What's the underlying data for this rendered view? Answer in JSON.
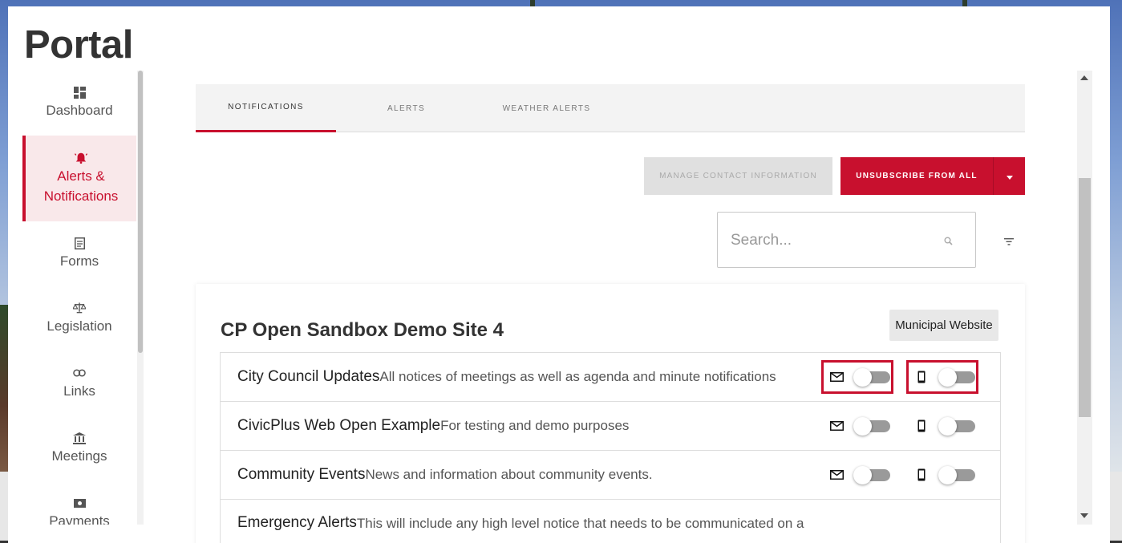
{
  "app": {
    "title": "Portal"
  },
  "sidebar": {
    "items": [
      {
        "label": "Dashboard",
        "icon": "dashboard-icon",
        "active": false
      },
      {
        "label": "Alerts & Notifications",
        "icon": "bell-icon",
        "active": true
      },
      {
        "label": "Forms",
        "icon": "form-icon",
        "active": false
      },
      {
        "label": "Legislation",
        "icon": "scales-icon",
        "active": false
      },
      {
        "label": "Links",
        "icon": "link-icon",
        "active": false
      },
      {
        "label": "Meetings",
        "icon": "institution-icon",
        "active": false
      },
      {
        "label": "Payments",
        "icon": "money-icon",
        "active": false
      }
    ]
  },
  "tabs": [
    {
      "label": "NOTIFICATIONS",
      "active": true
    },
    {
      "label": "ALERTS",
      "active": false
    },
    {
      "label": "WEATHER ALERTS",
      "active": false
    }
  ],
  "actions": {
    "manage_label": "MANAGE CONTACT INFORMATION",
    "unsubscribe_label": "UNSUBSCRIBE FROM ALL"
  },
  "search": {
    "placeholder": "Search...",
    "value": ""
  },
  "site": {
    "title": "CP Open Sandbox Demo Site 4",
    "badge": "Municipal Website",
    "items": [
      {
        "name": "City Council Updates",
        "description": "All notices of meetings as well as agenda and minute notifications",
        "email_on": false,
        "sms_on": false,
        "highlighted": true
      },
      {
        "name": "CivicPlus Web Open Example",
        "description": "For testing and demo purposes",
        "email_on": false,
        "sms_on": false,
        "highlighted": false
      },
      {
        "name": "Community Events",
        "description": "News and information about community events.",
        "email_on": false,
        "sms_on": false,
        "highlighted": false
      },
      {
        "name": "Emergency Alerts",
        "description": "This will include any high level notice that needs to be communicated on a",
        "email_on": false,
        "sms_on": false,
        "highlighted": false
      }
    ]
  },
  "colors": {
    "accent": "#c8102e",
    "accent_bg": "#f9e8ea",
    "toggle_off": "#9a9a9a"
  }
}
